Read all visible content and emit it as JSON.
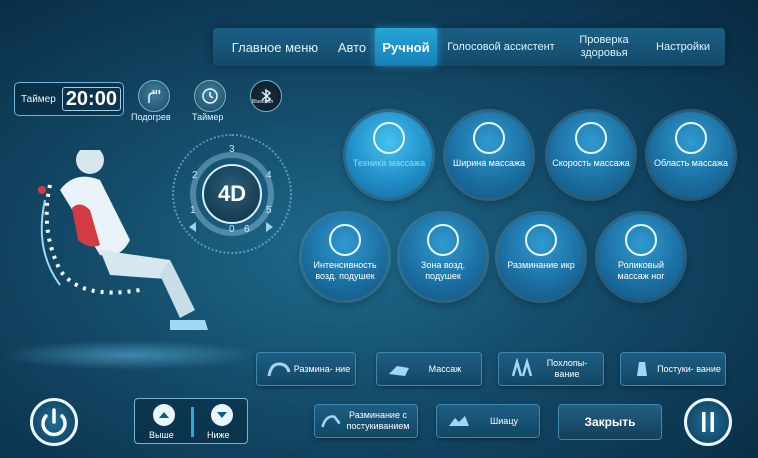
{
  "menu": {
    "items": [
      {
        "label": "Главное меню"
      },
      {
        "label": "Авто"
      },
      {
        "label": "Ручной"
      },
      {
        "label": "Голосовой ассистент"
      },
      {
        "label": "Проверка здоровья"
      },
      {
        "label": "Настройки"
      }
    ],
    "active": "Ручной"
  },
  "timer": {
    "label": "Таймер",
    "value": "20:00"
  },
  "quick": {
    "heat_label": "Подогрев",
    "timer_label": "Таймер",
    "bluetooth_label": "Bluetooth"
  },
  "dial": {
    "center_label": "4D",
    "levels": [
      "0",
      "1",
      "2",
      "3",
      "4",
      "5",
      "6"
    ]
  },
  "modes_row1": [
    {
      "label": "Техника массажа",
      "icon": "massage-technique-icon",
      "active": true
    },
    {
      "label": "Ширина массажа",
      "icon": "width-icon"
    },
    {
      "label": "Скорость массажа",
      "icon": "speed-bars-icon"
    },
    {
      "label": "Область массажа",
      "icon": "area-icon"
    }
  ],
  "modes_row2": [
    {
      "label": "Интенсивность возд. подушек",
      "icon": "airbag-intensity-icon"
    },
    {
      "label": "Зона возд. подушек",
      "icon": "airbag-zone-icon"
    },
    {
      "label": "Разминание икр",
      "icon": "calf-icon"
    },
    {
      "label": "Роликовый массаж ног",
      "icon": "foot-roller-icon"
    }
  ],
  "techniques": [
    {
      "label": "Размина- ние"
    },
    {
      "label": "Массаж"
    },
    {
      "label": "Похлопы- вание"
    },
    {
      "label": "Постуки- вание"
    },
    {
      "label": "Разминание с постукиванием"
    },
    {
      "label": "Шиацу"
    }
  ],
  "position": {
    "up_label": "Выше",
    "down_label": "Ниже"
  },
  "close_label": "Закрыть",
  "colors": {
    "accent": "#27a6d8",
    "background": "#144d6b",
    "active_text": "#7fe0ff"
  }
}
